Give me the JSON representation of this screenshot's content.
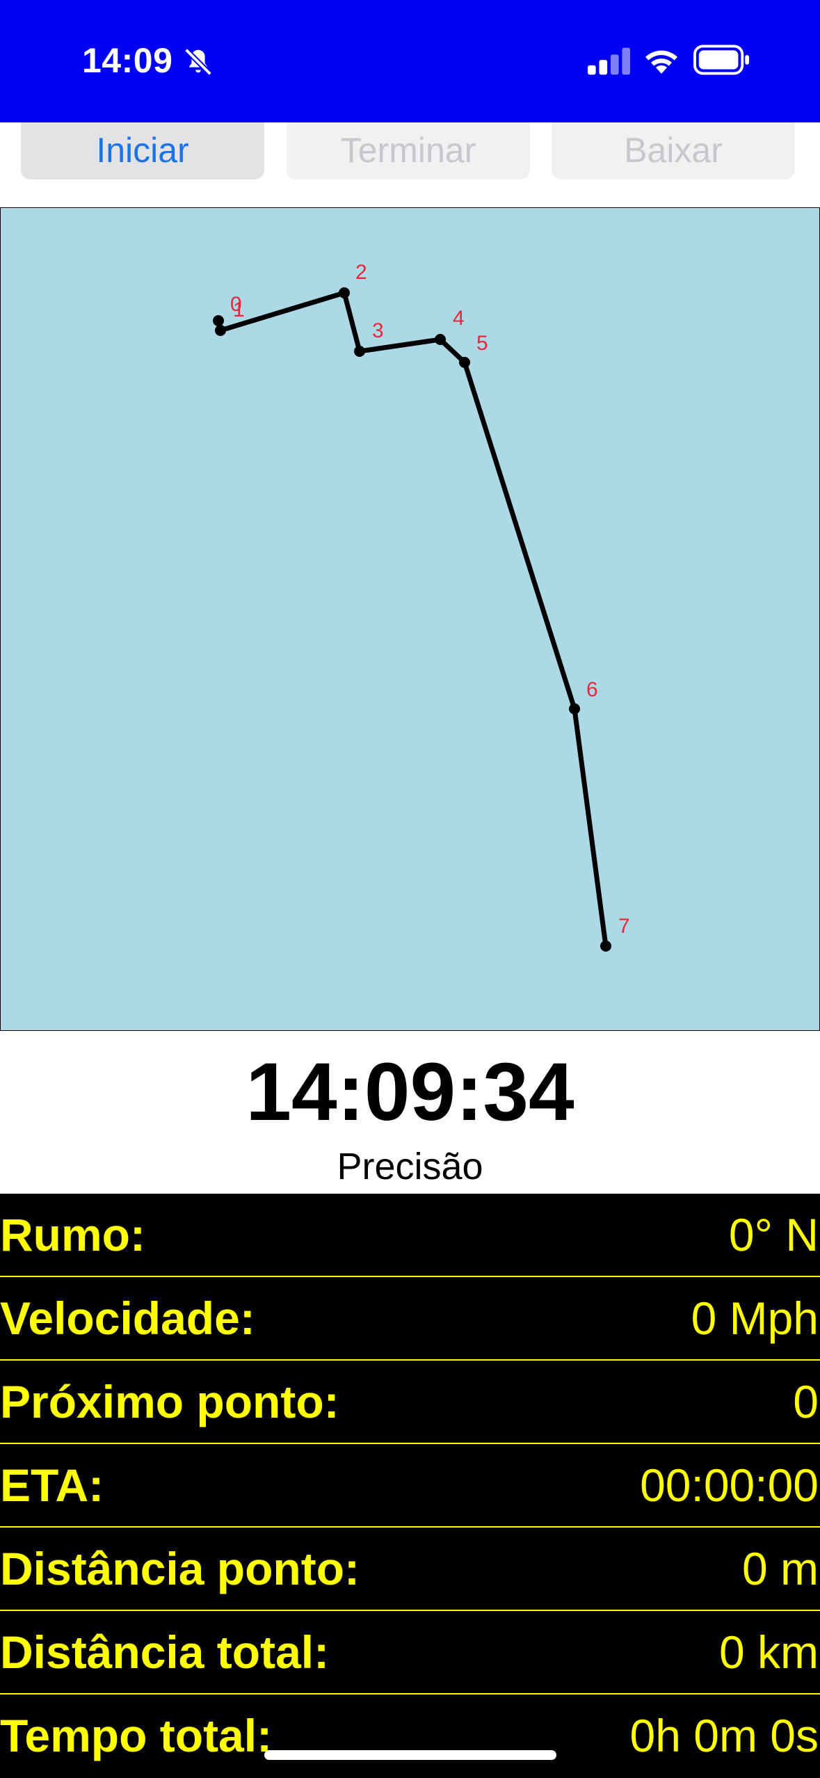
{
  "status_bar": {
    "time": "14:09",
    "icons": [
      "bell-slash-icon",
      "cellular-signal-icon",
      "wifi-icon",
      "battery-icon"
    ],
    "background": "#0000f5"
  },
  "toolbar": {
    "start_label": "Iniciar",
    "end_label": "Terminar",
    "download_label": "Baixar"
  },
  "map": {
    "background": "#add8e6",
    "route_color": "#000000",
    "label_color": "#e8283a",
    "point_labels": [
      "0",
      "1",
      "2",
      "3",
      "4",
      "5",
      "6",
      "7"
    ]
  },
  "clock": {
    "time": "14:09:34"
  },
  "precision_label": "Precisão",
  "stats": {
    "heading": {
      "label": "Rumo:",
      "value": "0° N"
    },
    "speed": {
      "label": "Velocidade:",
      "value": "0 Mph"
    },
    "next_point": {
      "label": "Próximo ponto:",
      "value": "0"
    },
    "eta": {
      "label": "ETA:",
      "value": "00:00:00"
    },
    "point_distance": {
      "label": "Distância ponto:",
      "value": "0 m"
    },
    "total_distance": {
      "label": "Distância total:",
      "value": "0 km"
    },
    "total_time": {
      "label": "Tempo total:",
      "value": "0h 0m 0s"
    }
  },
  "colors": {
    "stats_background": "#000000",
    "stats_text": "#ffff00",
    "accent": "#1a73e8"
  }
}
